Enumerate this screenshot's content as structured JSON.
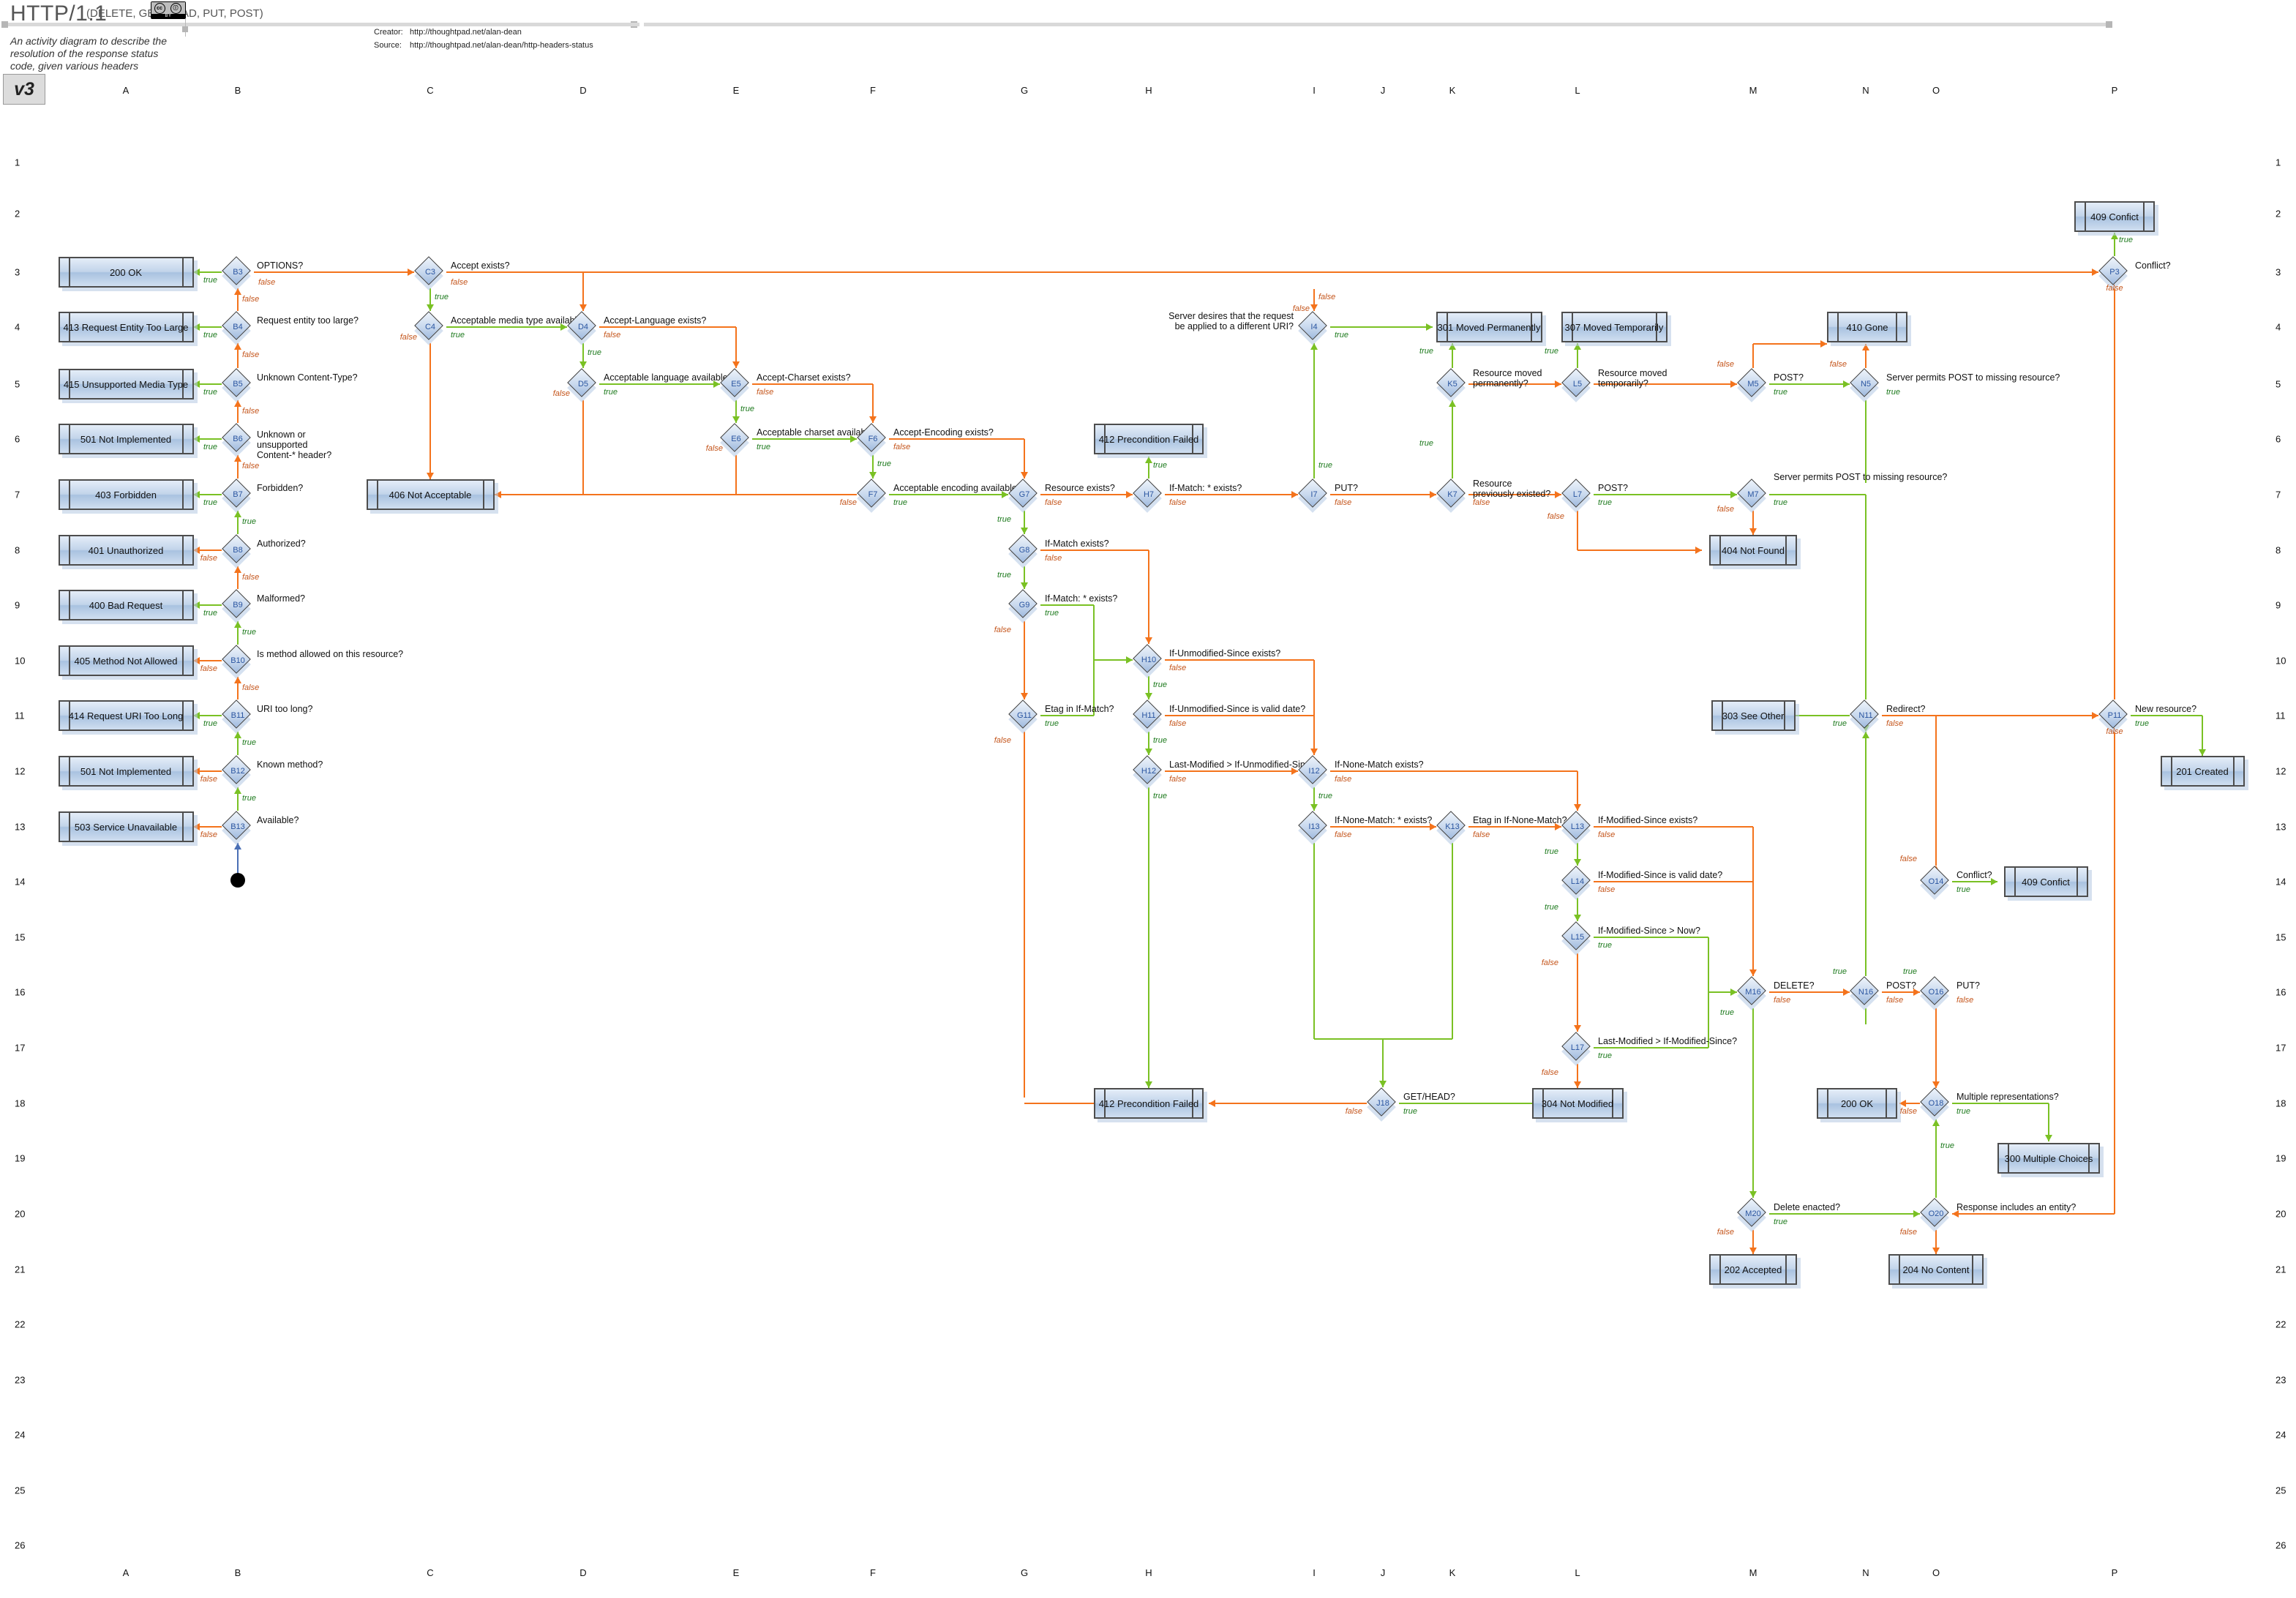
{
  "header": {
    "title": "HTTP/1.1",
    "methods": "(DELETE, GET, HEAD, PUT, POST)",
    "description": "An activity diagram to describe the resolution of the response status code, given various headers",
    "version": "v3",
    "license_badge": "cc-by-icon",
    "license_cc": "cc",
    "license_by": "BY",
    "creator_label": "Creator:",
    "creator_url": "http://thoughtpad.net/alan-dean",
    "source_label": "Source:",
    "source_url": "http://thoughtpad.net/alan-dean/http-headers-status"
  },
  "grid": {
    "columns": [
      "A",
      "B",
      "C",
      "D",
      "E",
      "F",
      "G",
      "H",
      "I",
      "J",
      "K",
      "L",
      "M",
      "N",
      "O",
      "P"
    ],
    "rows": [
      "1",
      "2",
      "3",
      "4",
      "5",
      "6",
      "7",
      "8",
      "9",
      "10",
      "11",
      "12",
      "13",
      "14",
      "15",
      "16",
      "17",
      "18",
      "19",
      "20",
      "21",
      "22",
      "23",
      "24",
      "25",
      "26"
    ]
  },
  "colors": {
    "true_edge": "#7ac124",
    "false_edge": "#f4731c",
    "start_edge": "#4a6fb5",
    "node_id_text": "#2a55a0",
    "true_label": "#1d7a1d",
    "false_label": "#c4541a"
  },
  "edge_labels": {
    "true": "true",
    "false": "false"
  },
  "responses": [
    {
      "id": "r200a",
      "label": "200 OK"
    },
    {
      "id": "r413",
      "label": "413 Request Entity Too Large"
    },
    {
      "id": "r415",
      "label": "415 Unsupported Media Type"
    },
    {
      "id": "r501a",
      "label": "501 Not Implemented"
    },
    {
      "id": "r403",
      "label": "403 Forbidden"
    },
    {
      "id": "r401",
      "label": "401 Unauthorized"
    },
    {
      "id": "r400",
      "label": "400 Bad Request"
    },
    {
      "id": "r405",
      "label": "405 Method Not Allowed"
    },
    {
      "id": "r414",
      "label": "414 Request URI Too Long"
    },
    {
      "id": "r501b",
      "label": "501 Not Implemented"
    },
    {
      "id": "r503",
      "label": "503 Service Unavailable"
    },
    {
      "id": "r406",
      "label": "406 Not Acceptable"
    },
    {
      "id": "r412a",
      "label": "412 Precondition Failed"
    },
    {
      "id": "r412b",
      "label": "412 Precondition Failed"
    },
    {
      "id": "r301",
      "label": "301 Moved Permanently"
    },
    {
      "id": "r307",
      "label": "307 Moved Temporarily"
    },
    {
      "id": "r410",
      "label": "410 Gone"
    },
    {
      "id": "r409top",
      "label": "409 Confict"
    },
    {
      "id": "r404",
      "label": "404 Not Found"
    },
    {
      "id": "r303",
      "label": "303 See Other"
    },
    {
      "id": "r201",
      "label": "201 Created"
    },
    {
      "id": "r409mid",
      "label": "409 Confict"
    },
    {
      "id": "r304",
      "label": "304 Not Modified"
    },
    {
      "id": "r200b",
      "label": "200 OK"
    },
    {
      "id": "r300",
      "label": "300 Multiple Choices"
    },
    {
      "id": "r202",
      "label": "202 Accepted"
    },
    {
      "id": "r204",
      "label": "204 No Content"
    }
  ],
  "decisions": [
    {
      "id": "B13",
      "question": "Available?"
    },
    {
      "id": "B12",
      "question": "Known method?"
    },
    {
      "id": "B11",
      "question": "URI too long?"
    },
    {
      "id": "B10",
      "question": "Is method allowed on this resource?"
    },
    {
      "id": "B9",
      "question": "Malformed?"
    },
    {
      "id": "B8",
      "question": "Authorized?"
    },
    {
      "id": "B7",
      "question": "Forbidden?"
    },
    {
      "id": "B6",
      "question": "Unknown or unsupported Content-* header?"
    },
    {
      "id": "B5",
      "question": "Unknown Content-Type?"
    },
    {
      "id": "B4",
      "question": "Request entity too large?"
    },
    {
      "id": "B3",
      "question": "OPTIONS?"
    },
    {
      "id": "C3",
      "question": "Accept exists?"
    },
    {
      "id": "C4",
      "question": "Acceptable media type available?"
    },
    {
      "id": "D4",
      "question": "Accept-Language exists?"
    },
    {
      "id": "D5",
      "question": "Acceptable language available?"
    },
    {
      "id": "E5",
      "question": "Accept-Charset exists?"
    },
    {
      "id": "E6",
      "question": "Acceptable charset available?"
    },
    {
      "id": "F6",
      "question": "Accept-Encoding exists?"
    },
    {
      "id": "F7",
      "question": "Acceptable encoding available?"
    },
    {
      "id": "G7",
      "question": "Resource exists?"
    },
    {
      "id": "G8",
      "question": "If-Match exists?"
    },
    {
      "id": "G9",
      "question": "If-Match: * exists?"
    },
    {
      "id": "G11",
      "question": "Etag in If-Match?"
    },
    {
      "id": "H7",
      "question": "If-Match: * exists?"
    },
    {
      "id": "H10",
      "question": "If-Unmodified-Since exists?"
    },
    {
      "id": "H11",
      "question": "If-Unmodified-Since is valid date?"
    },
    {
      "id": "H12",
      "question": "Last-Modified > If-Unmodified-Since?"
    },
    {
      "id": "I4",
      "question": "Server desires that the request be applied to a different URI?"
    },
    {
      "id": "I7",
      "question": "PUT?"
    },
    {
      "id": "I12",
      "question": "If-None-Match exists?"
    },
    {
      "id": "I13",
      "question": "If-None-Match: * exists?"
    },
    {
      "id": "J18",
      "question": "GET/HEAD?"
    },
    {
      "id": "K5",
      "question": "Resource moved permanently?"
    },
    {
      "id": "K7",
      "question": "Resource previously existed?"
    },
    {
      "id": "K13",
      "question": "Etag in If-None-Match?"
    },
    {
      "id": "L5",
      "question": "Resource moved temporarily?"
    },
    {
      "id": "L7",
      "question": "POST?"
    },
    {
      "id": "L13",
      "question": "If-Modified-Since exists?"
    },
    {
      "id": "L14",
      "question": "If-Modified-Since is valid date?"
    },
    {
      "id": "L15",
      "question": "If-Modified-Since > Now?"
    },
    {
      "id": "L17",
      "question": "Last-Modified > If-Modified-Since?"
    },
    {
      "id": "M5",
      "question": "POST?"
    },
    {
      "id": "M7",
      "question": "Server permits POST to missing resource?"
    },
    {
      "id": "M16",
      "question": "DELETE?"
    },
    {
      "id": "M20",
      "question": "Delete enacted?"
    },
    {
      "id": "N5",
      "question": "Server permits POST to missing resource?"
    },
    {
      "id": "N11",
      "question": "Redirect?"
    },
    {
      "id": "N16",
      "question": "POST?"
    },
    {
      "id": "O14",
      "question": "Conflict?"
    },
    {
      "id": "O16",
      "question": "PUT?"
    },
    {
      "id": "O18",
      "question": "Multiple representations?"
    },
    {
      "id": "O20",
      "question": "Response includes an entity?"
    },
    {
      "id": "P3",
      "question": "Conflict?"
    },
    {
      "id": "P11",
      "question": "New resource?"
    }
  ]
}
